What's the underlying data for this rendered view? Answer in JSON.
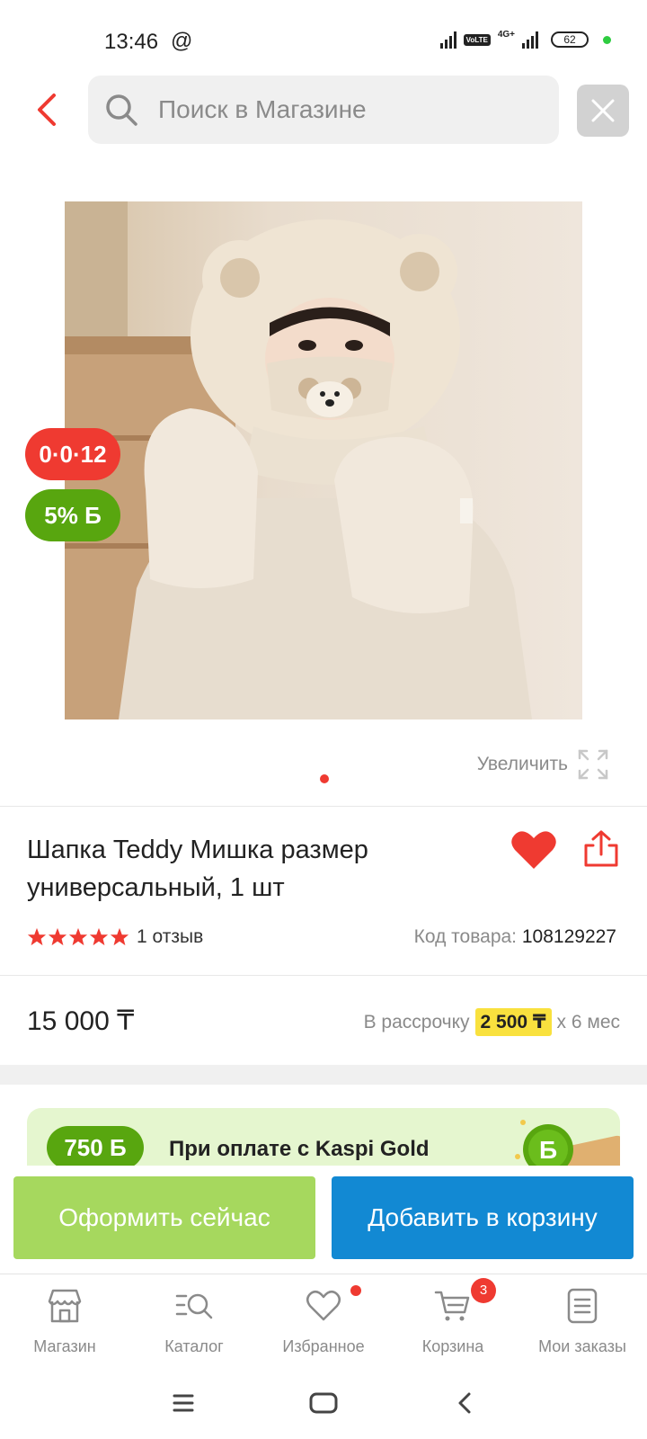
{
  "status_bar": {
    "time": "13:46",
    "at_symbol": "@",
    "network": "4G+",
    "volte": "VoLTE",
    "battery": "62"
  },
  "header": {
    "search_placeholder": "Поиск в Магазине"
  },
  "product": {
    "badge_installment": "0·0·12",
    "badge_bonus": "5%",
    "badge_bonus_unit": "Б",
    "zoom_label": "Увеличить",
    "title": "Шапка Teddy Мишка размер универсальный, 1 шт",
    "rating_stars": 5,
    "reviews": "1 отзыв",
    "code_label": "Код товара:",
    "code_value": "108129227",
    "price": "15 000 ₸",
    "installment_prefix": "В рассрочку",
    "installment_amount": "2 500 ₸",
    "installment_suffix": "х 6 мес"
  },
  "gold_banner": {
    "bonus": "750 Б",
    "text": "При оплате с Kaspi Gold"
  },
  "actions": {
    "buy_now": "Оформить сейчас",
    "add_to_cart": "Добавить в корзину"
  },
  "bottom_nav": {
    "items": [
      {
        "label": "Магазин",
        "icon": "store-icon"
      },
      {
        "label": "Каталог",
        "icon": "catalog-search-icon"
      },
      {
        "label": "Избранное",
        "icon": "heart-outline-icon"
      },
      {
        "label": "Корзина",
        "icon": "cart-icon"
      },
      {
        "label": "Мои заказы",
        "icon": "orders-icon"
      }
    ],
    "cart_count": "3"
  },
  "colors": {
    "accent_red": "#ef3a31",
    "accent_green": "#58a60f",
    "button_green": "#a6d85e",
    "button_blue": "#1289d3",
    "installment_yellow": "#f9e13e"
  }
}
